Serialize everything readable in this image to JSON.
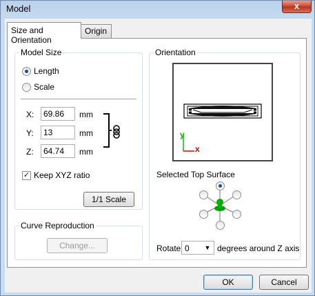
{
  "window": {
    "title": "Model",
    "close_glyph": "x"
  },
  "tabs": [
    {
      "label": "Size and Orientation",
      "active": true
    },
    {
      "label": "Origin",
      "active": false
    }
  ],
  "model_size": {
    "legend": "Model Size",
    "options": [
      {
        "label": "Length",
        "selected": true
      },
      {
        "label": "Scale",
        "selected": false
      }
    ],
    "fields": [
      {
        "axis": "X:",
        "value": "69.86",
        "unit": "mm"
      },
      {
        "axis": "Y:",
        "value": "13",
        "unit": "mm"
      },
      {
        "axis": "Z:",
        "value": "64.74",
        "unit": "mm"
      }
    ],
    "link_icon": "chain-link-icon",
    "keep_ratio": {
      "label": "Keep XYZ ratio",
      "checked": true,
      "mark": "✓"
    },
    "scale_button": "1/1 Scale"
  },
  "curve": {
    "legend": "Curve Reproduction",
    "change_button": "Change...",
    "change_enabled": false
  },
  "orientation": {
    "legend": "Orientation",
    "axis_y": "y",
    "axis_x": "x",
    "axis_y_color": "#00c000",
    "axis_x_color": "#e00000",
    "top_surface_label": "Selected Top Surface",
    "surface_selected": "top",
    "surface_accent": "#1b4f93",
    "surface_model_color": "#00b000",
    "rotate": {
      "label": "Rotate",
      "value": "0",
      "suffix": "degrees around Z axis",
      "arrow": "▼"
    }
  },
  "footer": {
    "ok": "OK",
    "cancel": "Cancel"
  }
}
